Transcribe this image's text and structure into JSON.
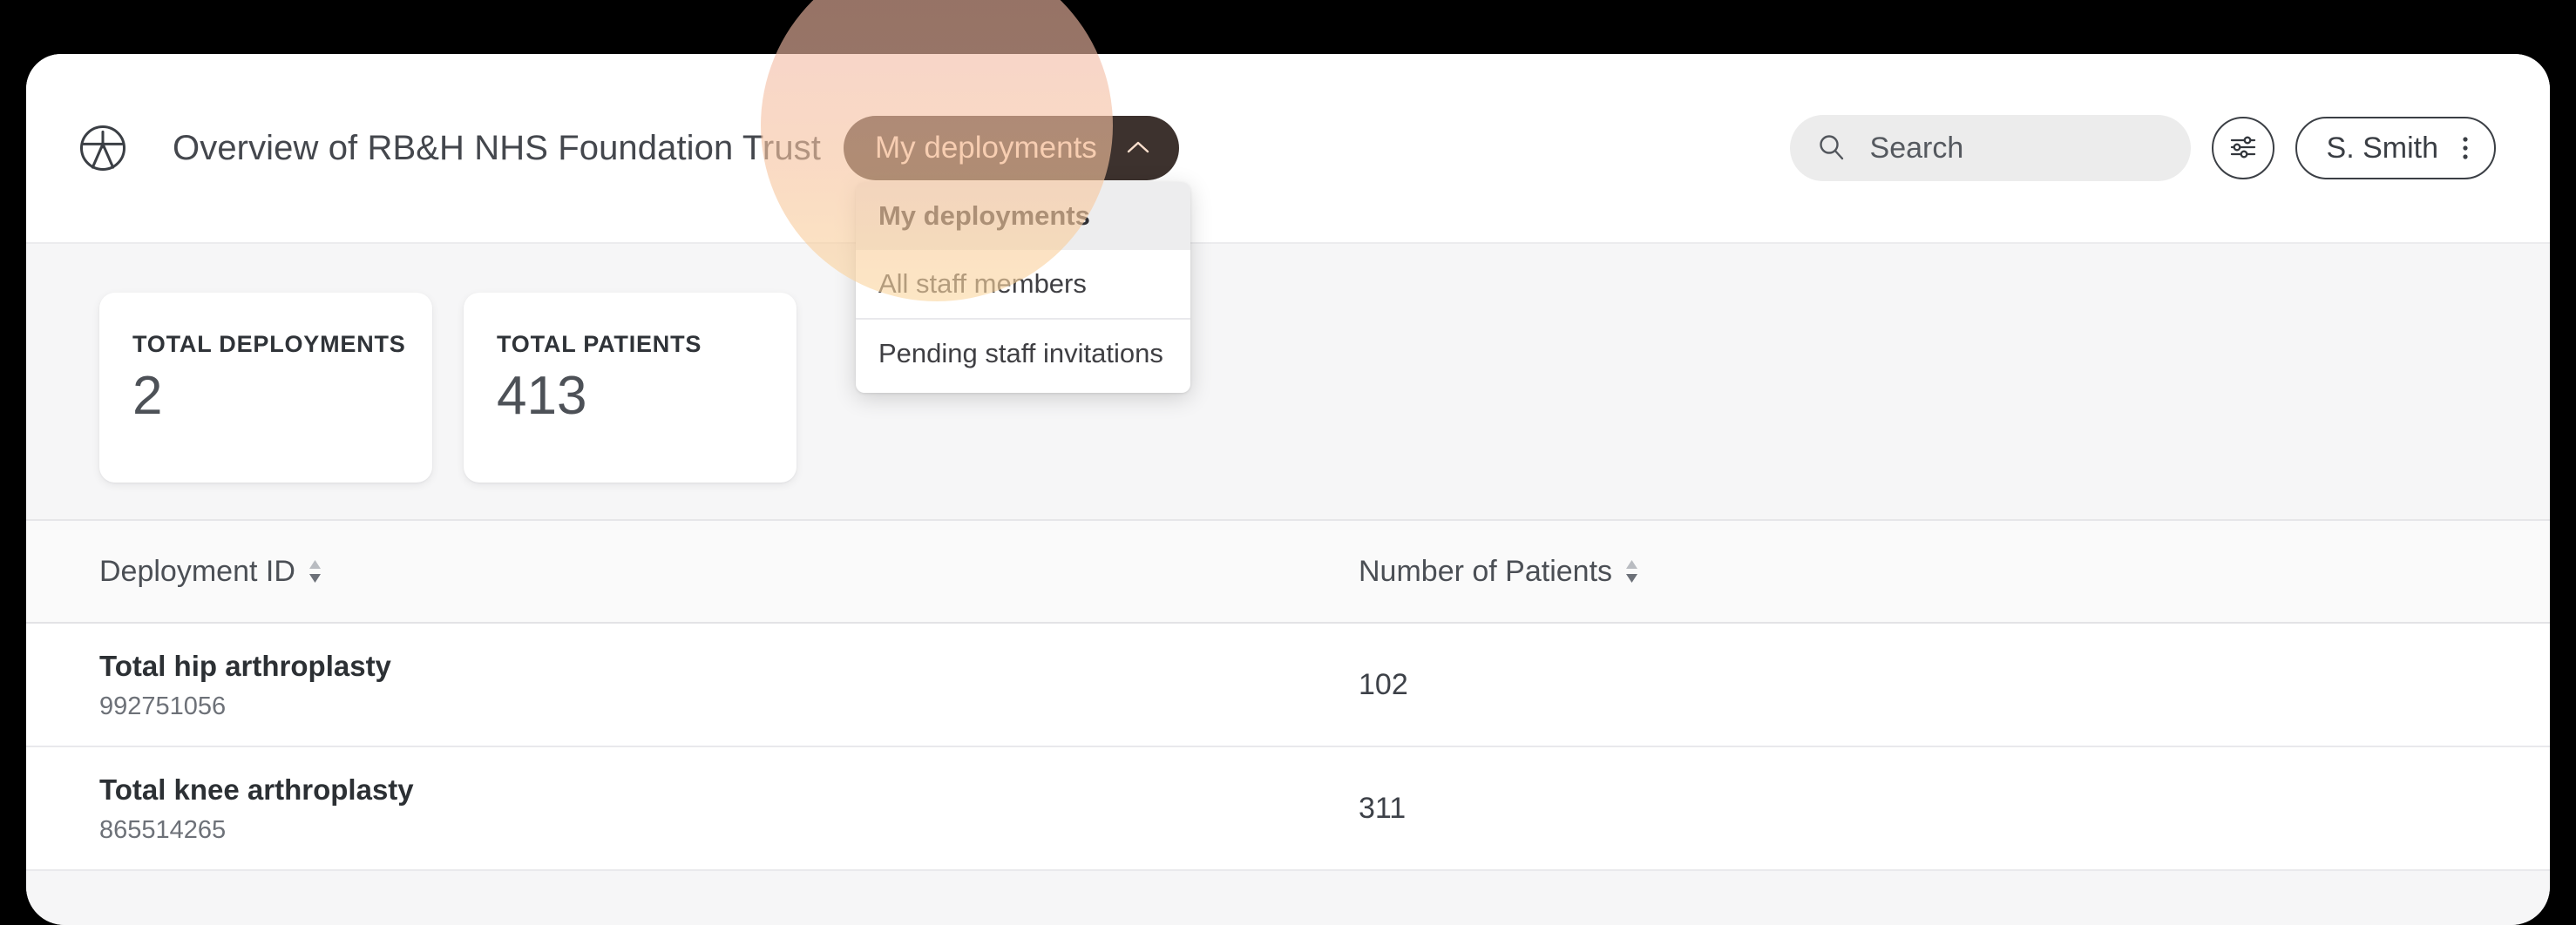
{
  "header": {
    "logo_icon": "accessibility-circle-logo",
    "title": "Overview of RB&H NHS Foundation Trust",
    "scope_dropdown": {
      "button_label": "My deployments",
      "chevron_icon": "chevron-up-icon",
      "expanded": true,
      "items": [
        {
          "label": "My deployments",
          "selected": true
        },
        {
          "label": "All staff members",
          "selected": false
        },
        {
          "label": "Pending staff invitations",
          "selected": false
        }
      ]
    },
    "search": {
      "icon": "search-icon",
      "value": "",
      "placeholder": "Search"
    },
    "filter_button": {
      "icon": "sliders-icon",
      "label": ""
    },
    "user_menu": {
      "name": "S. Smith",
      "icon": "kebab-menu-icon"
    }
  },
  "stats": [
    {
      "label": "TOTAL DEPLOYMENTS",
      "value": "2"
    },
    {
      "label": "TOTAL PATIENTS",
      "value": "413"
    }
  ],
  "table": {
    "columns": [
      {
        "label": "Deployment ID",
        "sort_icon": "sort-arrows-icon"
      },
      {
        "label": "Number of Patients",
        "sort_icon": "sort-arrows-icon"
      }
    ],
    "rows": [
      {
        "name": "Total hip arthroplasty",
        "id": "992751056",
        "patients": "102"
      },
      {
        "name": "Total knee arthroplasty",
        "id": "865514265",
        "patients": "311"
      }
    ]
  },
  "overlay": {
    "spotlight_icon": "focus-spotlight-circle"
  },
  "colors": {
    "accent_dark": "#3d322e",
    "accent_text": "#fadfcd",
    "spotlight_top": "#f2b6a4",
    "spotlight_bottom": "#fbd7a1",
    "page_background": "#f6f6f7",
    "surface": "#ffffff"
  }
}
